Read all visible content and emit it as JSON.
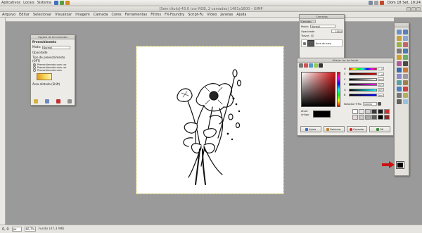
{
  "panel": {
    "menu": [
      "Aplicativos",
      "Locais",
      "Sistema"
    ],
    "clock": "Dom 18 Set, 19:24"
  },
  "window": {
    "title": "[Sem título]-43.0 (cor RGB, 2 camadas) 1481x1600 – GIMP"
  },
  "menubar": [
    "Arquivo",
    "Editar",
    "Selecionar",
    "Visualizar",
    "Imagem",
    "Camada",
    "Cores",
    "Ferramentas",
    "Filtros",
    "FX-Foundry",
    "Script-Fu",
    "Vídeo",
    "Janelas",
    "Ajuda"
  ],
  "toolopts": {
    "title": "Opções de ferramentas",
    "section": "Preenchimento",
    "mode_label": "Modo:",
    "mode_value": "Normal",
    "opacity_label": "Opacidade",
    "fill_type_label": "Tipo de preenchimento (OPT)",
    "options": [
      "Preenchimento com cor",
      "Preenchimento com cor",
      "Preenchimento com "
    ],
    "area_label": "Área afetada (Shift)"
  },
  "layers": {
    "title": "Camadas",
    "tab": "Camadas",
    "mode_label": "Modo:",
    "mode_value": "Normal",
    "opacity_label": "Opacidade",
    "opacity_value": "100,0",
    "lock_label": "Travar:",
    "layer_name": "Área de trans"
  },
  "colordlg": {
    "title": "Alterar cor da frente",
    "rows": [
      {
        "label": "H",
        "value": "0"
      },
      {
        "label": "S",
        "value": "0"
      },
      {
        "label": "V",
        "value": "0"
      },
      {
        "label": "R",
        "value": "0"
      },
      {
        "label": "G",
        "value": "0"
      },
      {
        "label": "B",
        "value": "0"
      }
    ],
    "row_values_shown": [
      "0",
      "0",
      "200",
      "255",
      "255",
      "255"
    ],
    "hex_label": "Notação HTML:",
    "hex_value": "000000",
    "current_label": "Atual:",
    "old_label": "Antigo:",
    "buttons": {
      "help": "Ajuda",
      "reset": "Reiniciar",
      "cancel": "Cancelar",
      "ok": "OK"
    },
    "swatches": [
      "#ffffff",
      "#e8e8e8",
      "#cfcfcf",
      "#3a3a3a",
      "#1a1a1a",
      "#d03030",
      "#e7d8d8",
      "#c9c9c9",
      "#a9a9a9",
      "#5e5e5e",
      "#000000",
      "#8a2a2a"
    ]
  },
  "statusbar": {
    "coords": "0, 0",
    "units": "px",
    "zoom": "66,7%",
    "info": "Fundo (47,3 MB)"
  },
  "colors": {
    "accent_red": "#cc1111",
    "canvas_bg": "#9a9a9a"
  }
}
